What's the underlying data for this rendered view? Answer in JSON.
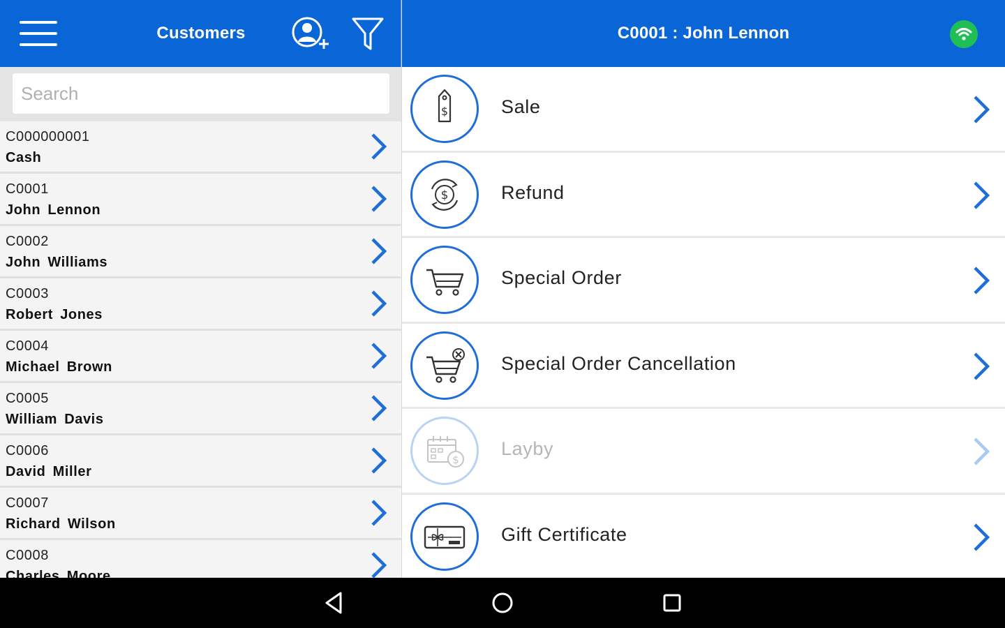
{
  "customers_panel": {
    "title": "Customers",
    "search_placeholder": "Search",
    "items": [
      {
        "code": "C000000001",
        "name": "Cash"
      },
      {
        "code": "C0001",
        "name": "John Lennon"
      },
      {
        "code": "C0002",
        "name": "John Williams"
      },
      {
        "code": "C0003",
        "name": "Robert Jones"
      },
      {
        "code": "C0004",
        "name": "Michael Brown"
      },
      {
        "code": "C0005",
        "name": "William Davis"
      },
      {
        "code": "C0006",
        "name": "David Miller"
      },
      {
        "code": "C0007",
        "name": "Richard Wilson"
      },
      {
        "code": "C0008",
        "name": "Charles Moore"
      }
    ]
  },
  "detail_panel": {
    "title": "C0001 : John Lennon",
    "actions": [
      {
        "label": "Sale",
        "icon": "price-tag-icon",
        "enabled": true
      },
      {
        "label": "Refund",
        "icon": "refund-dollar-icon",
        "enabled": true
      },
      {
        "label": "Special Order",
        "icon": "cart-icon",
        "enabled": true
      },
      {
        "label": "Special Order Cancellation",
        "icon": "cart-cancel-icon",
        "enabled": true
      },
      {
        "label": "Layby",
        "icon": "calendar-dollar-icon",
        "enabled": false
      },
      {
        "label": "Gift Certificate",
        "icon": "gift-card-icon",
        "enabled": true
      }
    ]
  },
  "colors": {
    "brand_blue": "#0a66d6",
    "icon_blue": "#1f6ed8",
    "online_green": "#1fbf55",
    "disabled_blue": "#b9d3f2"
  }
}
